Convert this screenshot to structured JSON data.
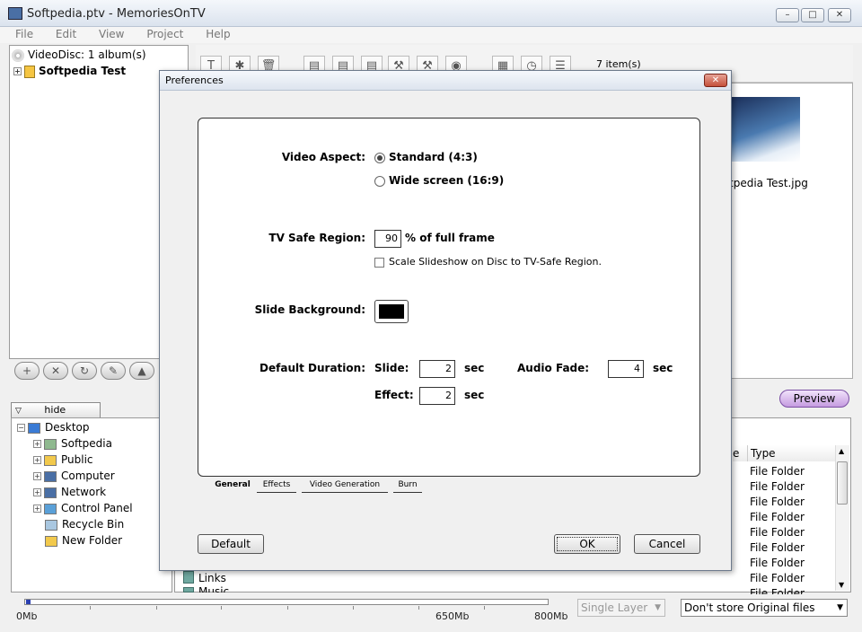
{
  "window": {
    "title": "Softpedia.ptv - MemoriesOnTV"
  },
  "menu": [
    "File",
    "Edit",
    "View",
    "Project",
    "Help"
  ],
  "project_tree": {
    "disc": "VideoDisc: 1 album(s)",
    "album": "Softpedia Test"
  },
  "toolbar": {
    "item_count": "7 item(s)"
  },
  "preview_area": {
    "thumbnail_caption": "tpedia Test.jpg"
  },
  "preview_button": "Preview",
  "hide_tab": "hide",
  "explorer_tree": [
    {
      "label": "Desktop",
      "icon": "desktop-icon",
      "color": "#3a7bd5"
    },
    {
      "label": "Softpedia",
      "icon": "user-folder-icon",
      "color": "#8fb98f"
    },
    {
      "label": "Public",
      "icon": "folder-icon",
      "color": "#f2c94c"
    },
    {
      "label": "Computer",
      "icon": "computer-icon",
      "color": "#4a6fa5"
    },
    {
      "label": "Network",
      "icon": "network-icon",
      "color": "#4a6fa5"
    },
    {
      "label": "Control Panel",
      "icon": "control-panel-icon",
      "color": "#5aa0d8"
    },
    {
      "label": "Recycle Bin",
      "icon": "recycle-bin-icon",
      "color": "#a9c7e0"
    },
    {
      "label": "New Folder",
      "icon": "folder-icon",
      "color": "#f2c94c"
    }
  ],
  "file_list": {
    "type_header": "Type",
    "size_header_fragment": "e",
    "types": [
      "File Folder",
      "File Folder",
      "File Folder",
      "File Folder",
      "File Folder",
      "File Folder",
      "File Folder",
      "File Folder",
      "File Folder"
    ],
    "names_visible": [
      "Links",
      "Music"
    ]
  },
  "status": {
    "scale_start": "0Mb",
    "scale_mid": "650Mb",
    "scale_end": "800Mb",
    "used_fraction": 0.008,
    "layer": "Single Layer",
    "store_option": "Don't store Original files"
  },
  "dialog": {
    "title": "Preferences",
    "close_glyph": "✕",
    "video_aspect_label": "Video Aspect:",
    "aspect_standard": "Standard (4:3)",
    "aspect_wide": "Wide screen (16:9)",
    "aspect_selected": "standard",
    "tv_safe_label": "TV Safe Region:",
    "tv_safe_value": "90",
    "tv_safe_suffix": "% of full frame",
    "scale_checkbox": "Scale Slideshow on Disc to TV-Safe Region.",
    "scale_checked": false,
    "slide_bg_label": "Slide Background:",
    "slide_bg_color": "#000000",
    "default_duration_label": "Default Duration:",
    "slide_label": "Slide:",
    "slide_value": "2",
    "effect_label": "Effect:",
    "effect_value": "2",
    "audio_fade_label": "Audio Fade:",
    "audio_fade_value": "4",
    "sec": "sec",
    "tabs": [
      "General",
      "Effects",
      "Video Generation",
      "Burn"
    ],
    "active_tab": "General",
    "default_button": "Default",
    "ok_button": "OK",
    "cancel_button": "Cancel"
  }
}
